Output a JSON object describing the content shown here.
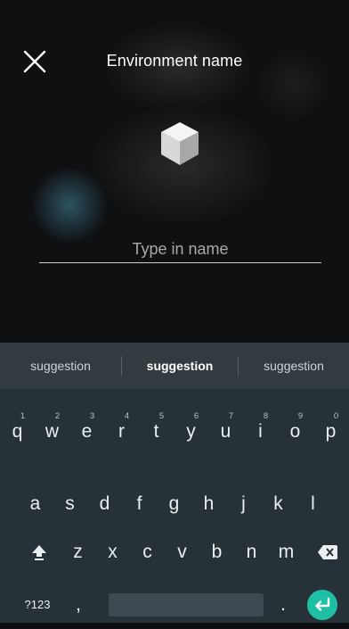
{
  "header": {
    "title": "Environment name",
    "close_icon": "close-icon"
  },
  "form": {
    "name_placeholder": "Type in name",
    "name_value": "",
    "cube_icon": "cube-icon"
  },
  "keyboard": {
    "suggestions": [
      "suggestion",
      "suggestion",
      "suggestion"
    ],
    "row1": [
      {
        "key": "q",
        "hint": "1"
      },
      {
        "key": "w",
        "hint": "2"
      },
      {
        "key": "e",
        "hint": "3"
      },
      {
        "key": "r",
        "hint": "4"
      },
      {
        "key": "t",
        "hint": "5"
      },
      {
        "key": "y",
        "hint": "6"
      },
      {
        "key": "u",
        "hint": "7"
      },
      {
        "key": "i",
        "hint": "8"
      },
      {
        "key": "o",
        "hint": "9"
      },
      {
        "key": "p",
        "hint": "0"
      }
    ],
    "row2": [
      "a",
      "s",
      "d",
      "f",
      "g",
      "h",
      "j",
      "k",
      "l"
    ],
    "row3": [
      "z",
      "x",
      "c",
      "v",
      "b",
      "n",
      "m"
    ],
    "symbols_label": "?123",
    "comma_label": ",",
    "period_label": ".",
    "shift_icon": "shift-icon",
    "backspace_icon": "backspace-icon",
    "enter_icon": "enter-icon",
    "enter_color": "#1fbfa6",
    "background_color": "#263238"
  }
}
